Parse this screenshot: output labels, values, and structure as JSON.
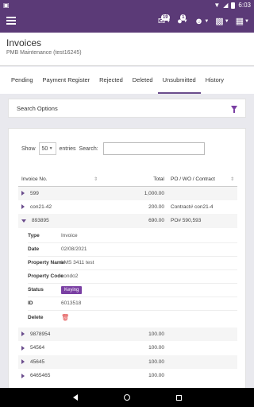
{
  "status_bar": {
    "time": "6:03"
  },
  "app_bar": {
    "mail_badge": "19",
    "globe_badge": "1"
  },
  "header": {
    "title": "Invoices",
    "subtitle": "PMB Maintenance (test16245)"
  },
  "tabs": [
    {
      "label": "Pending",
      "active": false
    },
    {
      "label": "Payment Register",
      "active": false
    },
    {
      "label": "Rejected",
      "active": false
    },
    {
      "label": "Deleted",
      "active": false
    },
    {
      "label": "Unsubmitted",
      "active": true
    },
    {
      "label": "History",
      "active": false
    }
  ],
  "search_options": {
    "label": "Search Options"
  },
  "table_controls": {
    "show_label": "Show",
    "page_size": "50",
    "entries_label": "entries",
    "search_label": "Search:",
    "search_value": ""
  },
  "table": {
    "columns": [
      "Invoice No.",
      "Total",
      "PO / WO / Contract"
    ],
    "rows_before": [
      {
        "invoice": "599",
        "total": "1,000.00",
        "contract": ""
      },
      {
        "invoice": "con21-42",
        "total": "200.00",
        "contract": "Contract# con21-4"
      }
    ],
    "expanded_row": {
      "invoice": "893895",
      "total": "690.00",
      "contract": "PO# 590,593"
    },
    "details": {
      "type_label": "Type",
      "type_value": "Invoice",
      "date_label": "Date",
      "date_value": "02/08/2021",
      "property_name_label": "Property Name",
      "property_name_value": "LMS 3411 test",
      "property_code_label": "Property Code",
      "property_code_value": "condo2",
      "status_label": "Status",
      "status_value": "Keying",
      "id_label": "ID",
      "id_value": "6013518",
      "delete_label": "Delete"
    },
    "rows_after": [
      {
        "invoice": "9878954",
        "total": "100.00",
        "contract": ""
      },
      {
        "invoice": "54564",
        "total": "100.00",
        "contract": ""
      },
      {
        "invoice": "45645",
        "total": "100.00",
        "contract": ""
      },
      {
        "invoice": "6465465",
        "total": "100.00",
        "contract": ""
      }
    ]
  },
  "colors": {
    "brand": "#5b3a77",
    "accent": "#7a3fa3",
    "delete": "#dd3333"
  }
}
